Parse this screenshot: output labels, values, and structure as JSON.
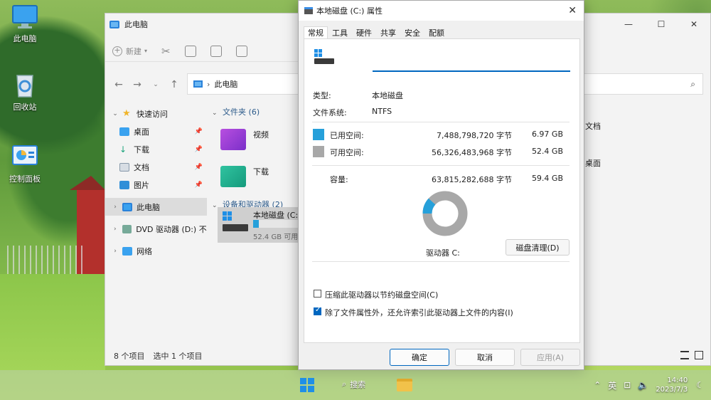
{
  "desktop": {
    "icons": [
      {
        "label": "此电脑"
      },
      {
        "label": "回收站"
      },
      {
        "label": "控制面板"
      }
    ]
  },
  "explorer": {
    "title": "此电脑",
    "toolbar": {
      "new_label": "新建"
    },
    "address": "此电脑",
    "sidebar": [
      {
        "label": "快速访问"
      },
      {
        "label": "桌面"
      },
      {
        "label": "下载"
      },
      {
        "label": "文档"
      },
      {
        "label": "图片"
      },
      {
        "label": "此电脑"
      },
      {
        "label": "DVD 驱动器 (D:) 不适"
      },
      {
        "label": "网络"
      }
    ],
    "folders_header": "文件夹 (6)",
    "folders": [
      {
        "label": "视频"
      },
      {
        "label": "下载"
      }
    ],
    "right_folders": [
      {
        "label": "文档"
      },
      {
        "label": "桌面"
      }
    ],
    "devices_header": "设备和驱动器 (2)",
    "drive": {
      "name": "本地磁盘 (C:",
      "free": "52.4 GB 可用",
      "used_fraction": 0.117
    },
    "status": {
      "count": "8 个项目",
      "selected": "选中 1 个项目"
    }
  },
  "dialog": {
    "title": "本地磁盘 (C:) 属性",
    "tabs": [
      "常规",
      "工具",
      "硬件",
      "共享",
      "安全",
      "配额"
    ],
    "name_value": "",
    "type_label": "类型:",
    "type_value": "本地磁盘",
    "fs_label": "文件系统:",
    "fs_value": "NTFS",
    "used_label": "已用空间:",
    "used_bytes": "7,488,798,720 字节",
    "used_gb": "6.97 GB",
    "free_label": "可用空间:",
    "free_bytes": "56,326,483,968 字节",
    "free_gb": "52.4 GB",
    "capacity_label": "容量:",
    "capacity_bytes": "63,815,282,688 字节",
    "capacity_gb": "59.4 GB",
    "drive_label": "驱动器 C:",
    "cleanup_button": "磁盘清理(D)",
    "compress_label": "压缩此驱动器以节约磁盘空间(C)",
    "compress_checked": false,
    "index_label": "除了文件属性外，还允许索引此驱动器上文件的内容(I)",
    "index_checked": true,
    "ok_button": "确定",
    "cancel_button": "取消",
    "apply_button": "应用(A)",
    "colors": {
      "used": "#26a0da",
      "free": "#a8a8a8"
    }
  },
  "taskbar": {
    "search_label": "搜索",
    "ime": "英",
    "time": "14:40",
    "date": "2023/7/3"
  }
}
